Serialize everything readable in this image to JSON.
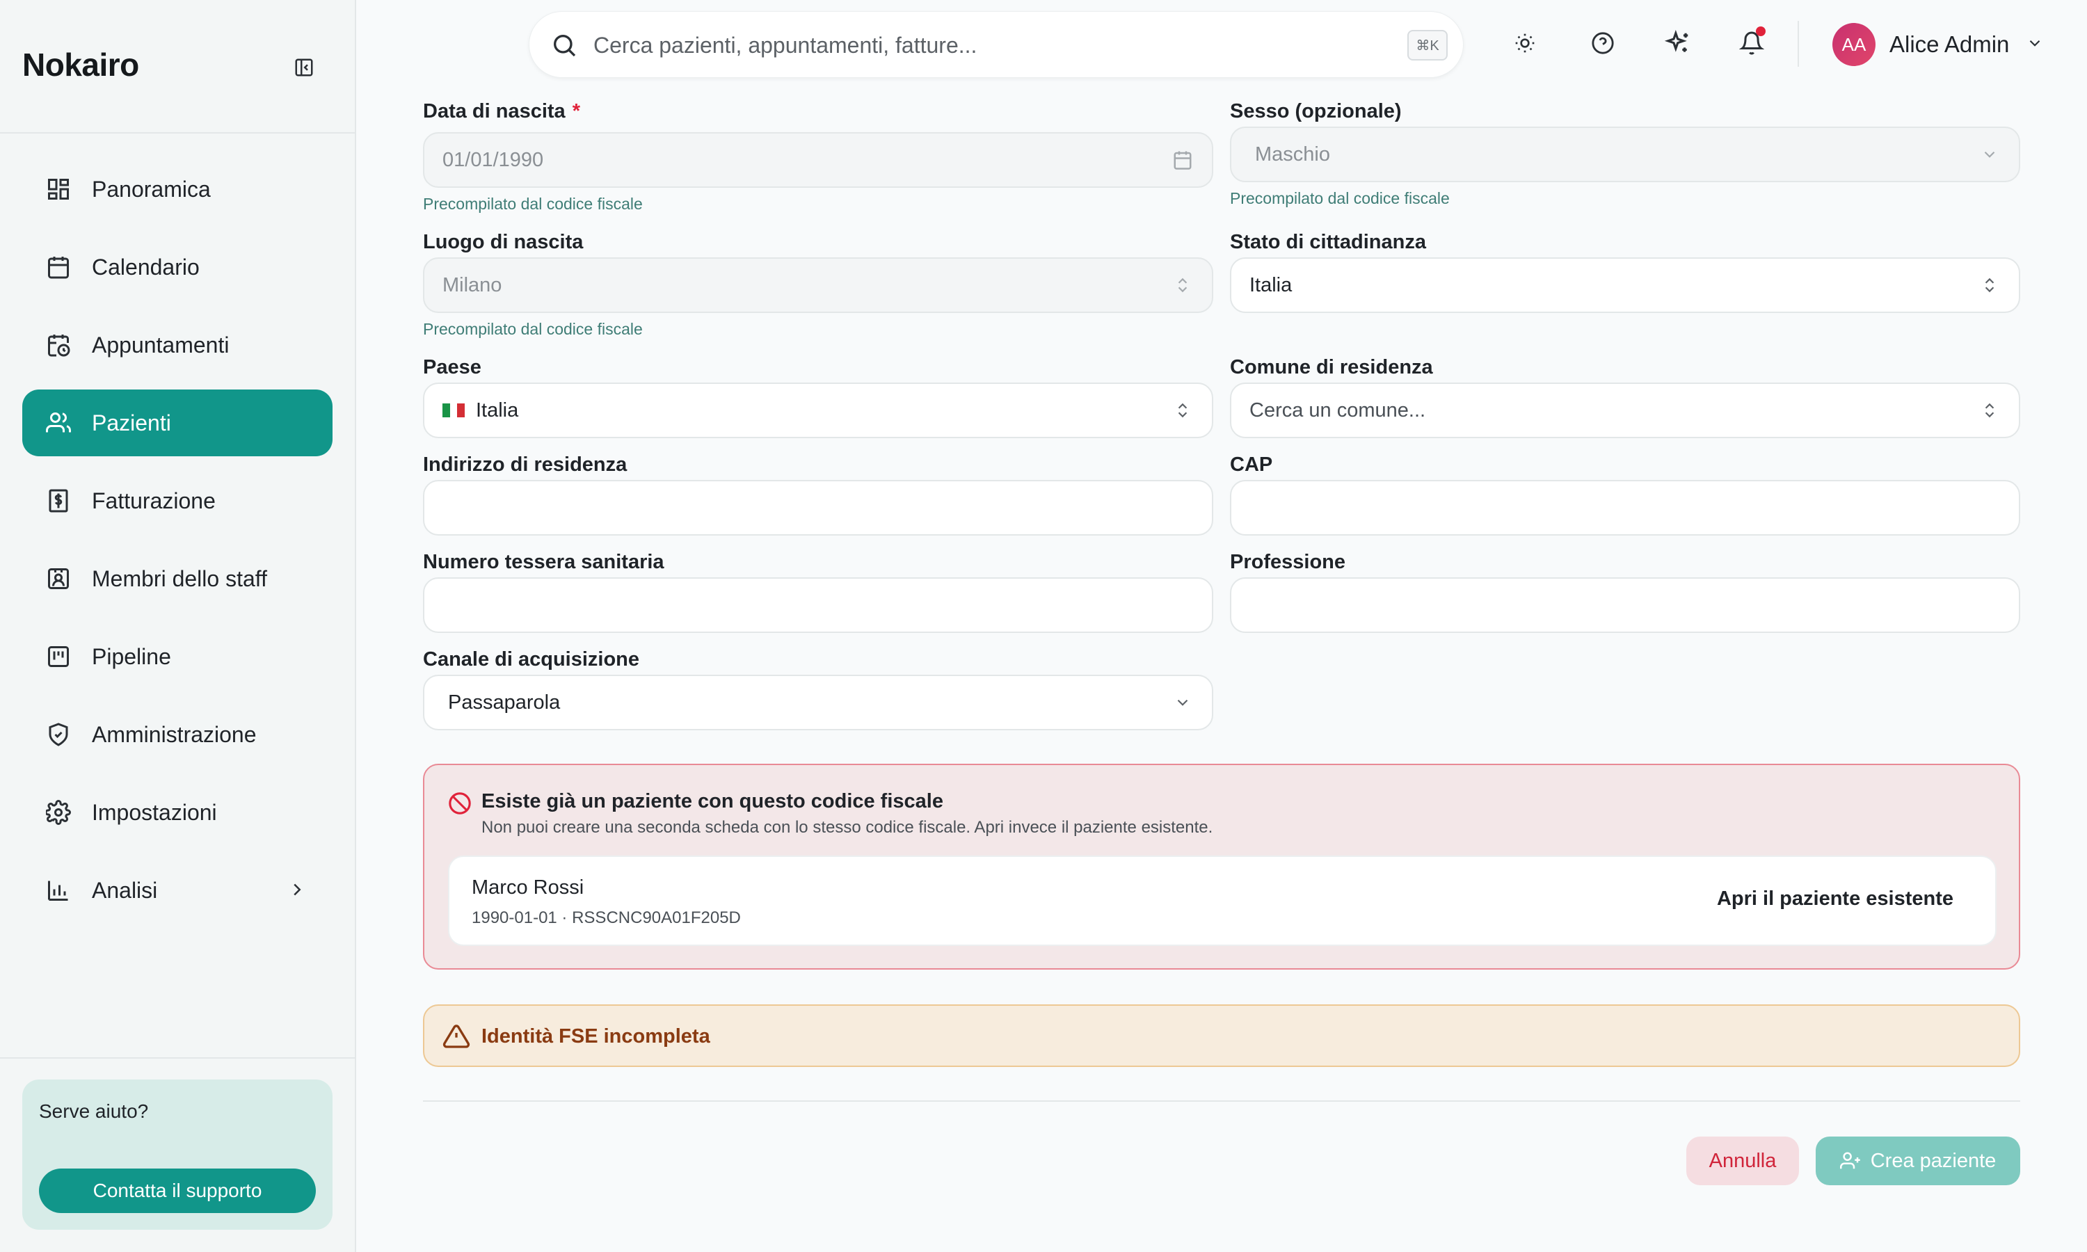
{
  "app": {
    "brand": "Nokairo"
  },
  "sidebar": {
    "items": [
      {
        "label": "Panoramica",
        "icon": "dashboard-icon"
      },
      {
        "label": "Calendario",
        "icon": "calendar-icon"
      },
      {
        "label": "Appuntamenti",
        "icon": "calendar-clock-icon"
      },
      {
        "label": "Pazienti",
        "icon": "users-icon",
        "active": true
      },
      {
        "label": "Fatturazione",
        "icon": "invoice-icon"
      },
      {
        "label": "Membri dello staff",
        "icon": "staff-badge-icon"
      },
      {
        "label": "Pipeline",
        "icon": "kanban-icon"
      },
      {
        "label": "Amministrazione",
        "icon": "shield-check-icon"
      },
      {
        "label": "Impostazioni",
        "icon": "gear-icon"
      },
      {
        "label": "Analisi",
        "icon": "bar-chart-icon"
      }
    ],
    "help": {
      "title": "Serve aiuto?",
      "button": "Contatta il supporto"
    }
  },
  "topbar": {
    "search_placeholder": "Cerca pazienti, appuntamenti, fatture...",
    "shortcut": "⌘K",
    "user": {
      "initials": "AA",
      "name": "Alice Admin"
    }
  },
  "form": {
    "birth_date": {
      "label": "Data di nascita",
      "required": "*",
      "value": "01/01/1990",
      "hint": "Precompilato dal codice fiscale"
    },
    "sex": {
      "label": "Sesso (opzionale)",
      "value": "Maschio",
      "hint": "Precompilato dal codice fiscale"
    },
    "birth_place": {
      "label": "Luogo di nascita",
      "value": "Milano",
      "hint": "Precompilato dal codice fiscale"
    },
    "citizenship": {
      "label": "Stato di cittadinanza",
      "value": "Italia"
    },
    "country": {
      "label": "Paese",
      "value": "Italia"
    },
    "municipality": {
      "label": "Comune di residenza",
      "placeholder": "Cerca un comune..."
    },
    "address": {
      "label": "Indirizzo di residenza",
      "value": ""
    },
    "cap": {
      "label": "CAP",
      "value": ""
    },
    "health_card": {
      "label": "Numero tessera sanitaria",
      "value": ""
    },
    "profession": {
      "label": "Professione",
      "value": ""
    },
    "acquisition": {
      "label": "Canale di acquisizione",
      "value": "Passaparola"
    }
  },
  "duplicate_alert": {
    "title": "Esiste già un paziente con questo codice fiscale",
    "description": "Non puoi creare una seconda scheda con lo stesso codice fiscale. Apri invece il paziente esistente.",
    "patient_name": "Marco Rossi",
    "patient_meta": "1990-01-01 · RSSCNC90A01F205D",
    "open_button": "Apri il paziente esistente"
  },
  "warning": {
    "text": "Identità FSE incompleta"
  },
  "actions": {
    "cancel": "Annulla",
    "create": "Crea paziente"
  },
  "colors": {
    "accent": "#11968a",
    "danger": "#e0223a",
    "warning_text": "#8a3b12"
  }
}
